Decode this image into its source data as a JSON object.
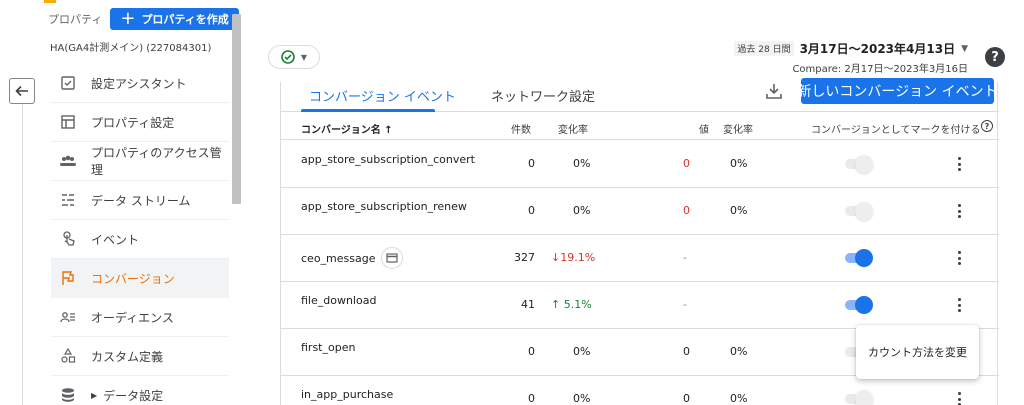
{
  "sidebar": {
    "property_label": "プロパティ",
    "create_button": "プロパティを作成",
    "property_name": "HA(GA4計測メイン) (227084301)",
    "items": [
      {
        "label": "設定アシスタント",
        "icon": "checklist-icon"
      },
      {
        "label": "プロパティ設定",
        "icon": "property-settings-icon"
      },
      {
        "label": "プロパティのアクセス管理",
        "icon": "people-icon"
      },
      {
        "label": "データ ストリーム",
        "icon": "data-stream-icon"
      },
      {
        "label": "イベント",
        "icon": "touch-icon"
      },
      {
        "label": "コンバージョン",
        "icon": "flag-icon",
        "active": true
      },
      {
        "label": "オーディエンス",
        "icon": "audience-icon"
      },
      {
        "label": "カスタム定義",
        "icon": "shapes-icon"
      },
      {
        "label": "データ設定",
        "icon": "database-icon"
      }
    ]
  },
  "header": {
    "date_badge": "過去 28 日間",
    "date_range": "3月17日～2023年4月13日",
    "compare": "Compare: 2月17日～2023年3月16日",
    "help": "?"
  },
  "tabs": {
    "conversion_events": "コンバージョン イベント",
    "network_settings": "ネットワーク設定",
    "new_button": "新しいコンバージョン イベント"
  },
  "table": {
    "headers": {
      "name": "コンバージョン名 ↑",
      "count": "件数",
      "count_change": "変化率",
      "value": "値",
      "value_change": "変化率",
      "mark": "コンバージョンとしてマークを付ける"
    },
    "rows": [
      {
        "name": "app_store_subscription_convert",
        "count": "0",
        "rate": "0%",
        "rate_dir": "zero",
        "value": "0",
        "value_style": "red",
        "vrate": "0%",
        "toggle": false,
        "calendar": false
      },
      {
        "name": "app_store_subscription_renew",
        "count": "0",
        "rate": "0%",
        "rate_dir": "zero",
        "value": "0",
        "value_style": "red",
        "vrate": "0%",
        "toggle": false,
        "calendar": false
      },
      {
        "name": "ceo_message",
        "count": "327",
        "rate": "19.1%",
        "rate_dir": "down",
        "value": "-",
        "value_style": "dash",
        "vrate": "",
        "toggle": true,
        "calendar": true
      },
      {
        "name": "file_download",
        "count": "41",
        "rate": "5.1%",
        "rate_dir": "up",
        "value": "-",
        "value_style": "dash",
        "vrate": "",
        "toggle": true,
        "calendar": false
      },
      {
        "name": "first_open",
        "count": "0",
        "rate": "0%",
        "rate_dir": "zero",
        "value": "0",
        "value_style": "plain",
        "vrate": "0%",
        "toggle": false,
        "calendar": false
      },
      {
        "name": "in_app_purchase",
        "count": "0",
        "rate": "0%",
        "rate_dir": "zero",
        "value": "0",
        "value_style": "plain",
        "vrate": "0%",
        "toggle": false,
        "calendar": false
      }
    ]
  },
  "popup": {
    "label": "カウント方法を変更"
  },
  "colors": {
    "accent": "#1a73e8",
    "active_nav": "#e8710a",
    "down": "#d93025",
    "up": "#188038"
  }
}
